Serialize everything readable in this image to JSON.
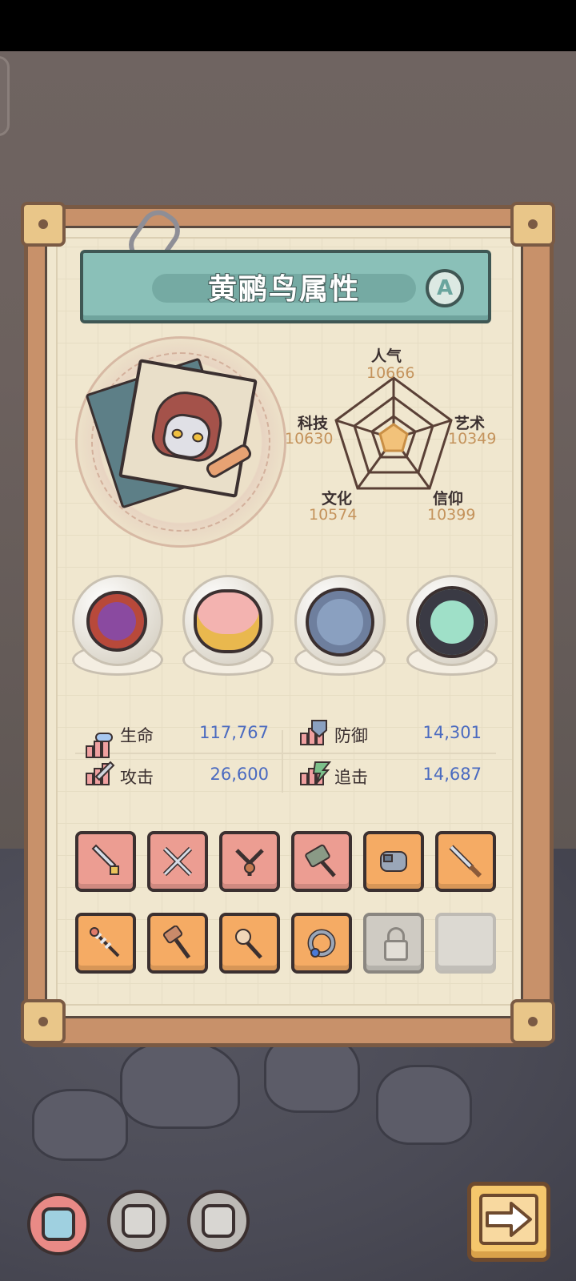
{
  "header": {
    "title": "黄鹂鸟属性",
    "rank": "A"
  },
  "radar": {
    "stats": [
      {
        "name": "人气",
        "value": "10666"
      },
      {
        "name": "艺术",
        "value": "10349"
      },
      {
        "name": "信仰",
        "value": "10399"
      },
      {
        "name": "文化",
        "value": "10574"
      },
      {
        "name": "科技",
        "value": "10630"
      }
    ]
  },
  "relics": [
    {
      "icon": "thorn-vine-relic-icon"
    },
    {
      "icon": "brain-relic-icon"
    },
    {
      "icon": "compass-relic-icon"
    },
    {
      "icon": "dark-portal-relic-icon"
    }
  ],
  "stats": {
    "hp": {
      "label": "生命",
      "value": "117,767"
    },
    "defense": {
      "label": "防御",
      "value": "14,301"
    },
    "attack": {
      "label": "攻击",
      "value": "26,600"
    },
    "pursuit": {
      "label": "追击",
      "value": "14,687"
    }
  },
  "equipment": {
    "row1": [
      "sword-icon",
      "crossed-daggers-icon",
      "slingshot-icon",
      "war-hammer-icon",
      "gauntlet-icon",
      "dagger-icon"
    ],
    "row2": [
      "fishbone-sword-icon",
      "mallet-icon",
      "pointing-wand-icon",
      "gem-ring-icon",
      "lock-icon",
      "empty-slot"
    ]
  },
  "colors": {
    "rank": "#6aa59e",
    "stat_value": "#4a6ac0",
    "radar_value": "#c4935c",
    "slot_red": "#ec9d92",
    "slot_orange": "#f5ab64"
  }
}
